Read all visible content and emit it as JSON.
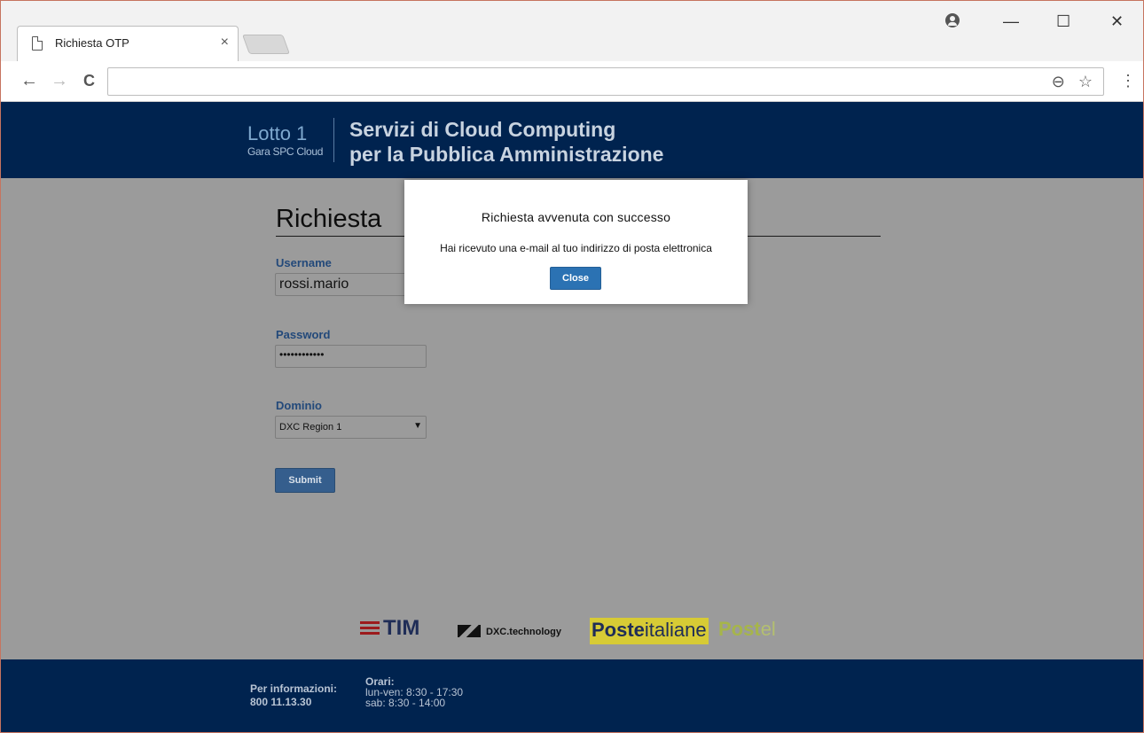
{
  "browser": {
    "tab_title": "Richiesta OTP",
    "tab_close": "×",
    "win_minimize": "—",
    "win_maximize": "☐",
    "win_close": "✕",
    "nav_back": "←",
    "nav_forward": "→",
    "nav_reload": "C",
    "omnibox_value": "",
    "zoom_icon": "⊖",
    "bookmark_icon": "☆",
    "menu_icon": "⋮"
  },
  "header": {
    "lotto": "Lotto 1",
    "gara": "Gara SPC Cloud",
    "title_line1": "Servizi di Cloud Computing",
    "title_line2": "per la Pubblica Amministrazione"
  },
  "form": {
    "heading": "Richiesta",
    "username_label": "Username",
    "username_value": "rossi.mario",
    "password_label": "Password",
    "password_value": "••••••••••••",
    "dominio_label": "Dominio",
    "dominio_value": "DXC Region 1",
    "dominio_arrow": "▼",
    "submit_label": "Submit"
  },
  "partners": {
    "tim": "TIM",
    "dxc": "DXC.technology",
    "poste_bold": "Poste",
    "poste_rest": "italiane",
    "postel_bold": "Post",
    "postel_rest": "el"
  },
  "footer": {
    "info_label": "Per informazioni:",
    "info_phone": "800 11.13.30",
    "orari_label": "Orari:",
    "orari_week": "lun-ven: 8:30 - 17:30",
    "orari_sat": "sab: 8:30 - 14:00"
  },
  "modal": {
    "title": "Richiesta avvenuta con successo",
    "message": "Hai ricevuto una e-mail al tuo indirizzo di posta elettronica",
    "close_label": "Close"
  }
}
